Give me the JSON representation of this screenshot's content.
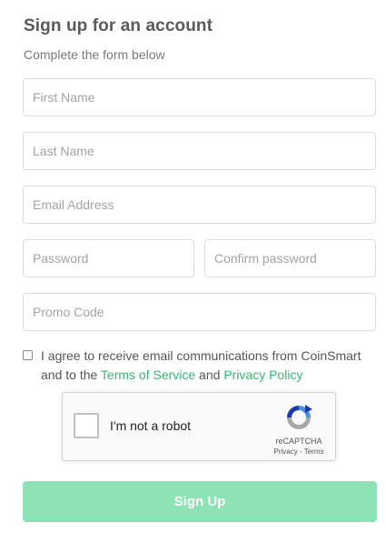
{
  "header": {
    "title": "Sign up for an account",
    "subtitle": "Complete the form below"
  },
  "form": {
    "first_name": {
      "placeholder": "First Name",
      "value": ""
    },
    "last_name": {
      "placeholder": "Last Name",
      "value": ""
    },
    "email": {
      "placeholder": "Email Address",
      "value": ""
    },
    "password": {
      "placeholder": "Password",
      "value": ""
    },
    "confirm_password": {
      "placeholder": "Confirm password",
      "value": ""
    },
    "promo_code": {
      "placeholder": "Promo Code",
      "value": ""
    }
  },
  "agreement": {
    "checked": false,
    "text_before": "I agree to receive email communications from CoinSmart and to the ",
    "terms_link": "Terms of Service",
    "and_text": " and ",
    "privacy_link": "Privacy Policy",
    "link_color": "#3cb371"
  },
  "recaptcha": {
    "label": "I'm not a robot",
    "brand": "reCAPTCHA",
    "links": "Privacy - Terms",
    "icon": "recaptcha-logo-icon"
  },
  "submit": {
    "label": "Sign Up",
    "color": "#8ee3b5"
  }
}
